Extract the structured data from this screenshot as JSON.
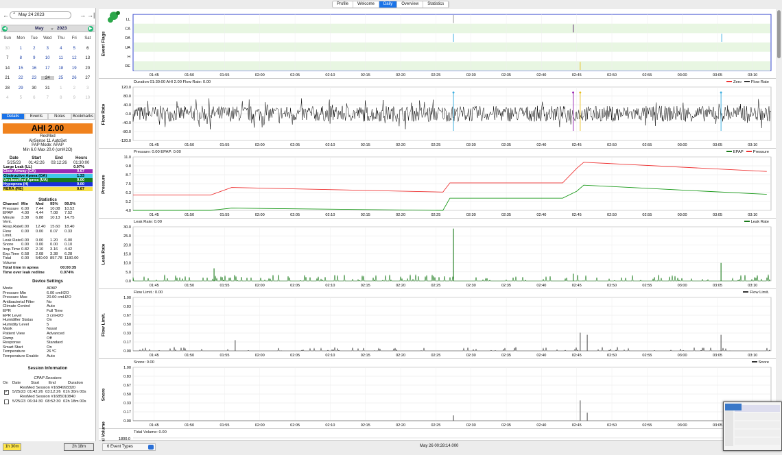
{
  "top_tabs": [
    "Profile",
    "Welcome",
    "Daily",
    "Overview",
    "Statistics"
  ],
  "active_tab": "Daily",
  "nav": {
    "prev": "←",
    "date": "May 24 2023",
    "next": "→",
    "last": "→|"
  },
  "calendar": {
    "month": "May",
    "year": "2023",
    "weekdays": [
      "Sun",
      "Mon",
      "Tue",
      "Wed",
      "Thu",
      "Fri",
      "Sat"
    ],
    "weeks": [
      [
        "30",
        "1",
        "2",
        "3",
        "4",
        "5",
        "6"
      ],
      [
        "7",
        "8",
        "9",
        "10",
        "11",
        "12",
        "13"
      ],
      [
        "14",
        "15",
        "16",
        "17",
        "18",
        "19",
        "20"
      ],
      [
        "21",
        "22",
        "23",
        "24",
        "25",
        "26",
        "27"
      ],
      [
        "28",
        "29",
        "30",
        "31",
        "1",
        "2",
        "3"
      ],
      [
        "4",
        "5",
        "6",
        "7",
        "8",
        "9",
        "10"
      ]
    ]
  },
  "sub_tabs": [
    "Details",
    "Events",
    "Notes",
    "Bookmarks"
  ],
  "ahi": "AHI 2.00",
  "machine": {
    "brand": "ResMed",
    "model": "AirSense 11 AutoSet",
    "mode": "PAP Mode: APAP",
    "range": "Min 6.0 Max 20.0 (cmH2O)"
  },
  "summary": {
    "headers": [
      "Date",
      "Start",
      "End",
      "Hours"
    ],
    "values": [
      "5/25/23",
      "01:42:26",
      "03:12:26",
      "01:30:00"
    ]
  },
  "events": [
    {
      "label": "Large Leak (LL)",
      "value": "0.07%",
      "color": "#ffffff",
      "text": "#000"
    },
    {
      "label": "Clear Airway (CA)",
      "value": "0.67",
      "color": "#9b2bb3",
      "text": "#fff"
    },
    {
      "label": "Obstructive Apnea (OA)",
      "value": "1.33",
      "color": "#40c8e8",
      "text": "#000"
    },
    {
      "label": "Unclassified Apnea (UA)",
      "value": "0.00",
      "color": "#1a7a1a",
      "text": "#fff"
    },
    {
      "label": "Hypopnea (H)",
      "value": "0.00",
      "color": "#1a2fd8",
      "text": "#fff"
    },
    {
      "label": "RERA (RE)",
      "value": "0.67",
      "color": "#f4e04a",
      "text": "#000"
    }
  ],
  "stats": {
    "title": "Statistics",
    "headers": [
      "Channel",
      "Min",
      "Med",
      "95%",
      "99.5%"
    ],
    "rows": [
      [
        "Pressure",
        "6.00",
        "7.44",
        "10.08",
        "10.52"
      ],
      [
        "EPAP",
        "4.00",
        "4.44",
        "7.08",
        "7.52"
      ],
      [
        "Minute",
        "3.38",
        "6.88",
        "10.13",
        "14.75"
      ],
      [
        "Vent.",
        "",
        "",
        "",
        ""
      ],
      [
        "Resp.Rate",
        "0.00",
        "12.40",
        "15.60",
        "18.40"
      ],
      [
        "Flow Limit.",
        "0.00",
        "0.00",
        "0.07",
        "0.33"
      ],
      [
        "Leak Rate",
        "0.00",
        "0.00",
        "1.20",
        "6.00"
      ],
      [
        "Snore",
        "0.00",
        "0.00",
        "0.00",
        "0.10"
      ],
      [
        "Insp.Time",
        "0.82",
        "2.10",
        "3.16",
        "4.42"
      ],
      [
        "Exp.Time",
        "0.58",
        "2.68",
        "3.38",
        "6.28"
      ],
      [
        "Tidal",
        "0.00",
        "540.00",
        "857.78",
        "1180.00"
      ],
      [
        "Volume",
        "",
        "",
        "",
        ""
      ]
    ],
    "apnea_label": "Total time in apnea",
    "apnea_value": "00:00:35",
    "leak_label": "Time over leak redline",
    "leak_value": "0.074%"
  },
  "device": {
    "title": "Device Settings",
    "rows": [
      [
        "Mode",
        "APAP"
      ],
      [
        "Pressure Min",
        "6.00 cmH2O"
      ],
      [
        "Pressure Max",
        "20.00 cmH2O"
      ],
      [
        "Antibacterial Filter",
        "No"
      ],
      [
        "Climate Control",
        "Auto"
      ],
      [
        "EPR",
        "Full Time"
      ],
      [
        "EPR Level",
        "3 cmH2O"
      ],
      [
        "Humidifier Status",
        "On"
      ],
      [
        "Humidity Level",
        "5"
      ],
      [
        "Mask",
        "Nasal"
      ],
      [
        "Patient View",
        "Advanced"
      ],
      [
        "Ramp",
        "Off"
      ],
      [
        "Response",
        "Standard"
      ],
      [
        "Smart Start",
        "On"
      ],
      [
        "Temperature",
        "26 ºC"
      ],
      [
        "Temperature Enable",
        "Auto"
      ]
    ]
  },
  "sessions": {
    "title": "Session Information",
    "subtitle": "CPAP Sessions",
    "headers": [
      "On",
      "Date",
      "Start",
      "End",
      "Duration"
    ],
    "items": [
      {
        "name": "ResMed Session #1684993320",
        "date": "5/25/23",
        "start": "01:42:26",
        "end": "03:12:26",
        "duration": "01h 30m 00s",
        "checked": true
      },
      {
        "name": "ResMed Session #1685010840",
        "date": "5/25/23",
        "start": "06:34:30",
        "end": "08:52:30",
        "duration": "02h 18m 00s",
        "checked": false
      }
    ]
  },
  "bottom_left": {
    "btn1": "1h 30m",
    "btn2": "2h 18m"
  },
  "bottom": {
    "event_types": "6 Event Types",
    "time": "May 26 00:28:14.000"
  },
  "x_ticks": [
    "01:45",
    "01:50",
    "01:55",
    "02:00",
    "02:05",
    "02:10",
    "02:15",
    "02:20",
    "02:25",
    "02:30",
    "02:35",
    "02:40",
    "02:45",
    "02:50",
    "02:55",
    "03:00",
    "03:05",
    "03:10"
  ],
  "chart_data": [
    {
      "type": "line",
      "title": "Event Flags",
      "ylabel": "Event Flags",
      "categories": [
        "LL",
        "CA",
        "OA",
        "UA",
        "H",
        "RE"
      ],
      "events": [
        {
          "flag": "LL",
          "time": "02:27"
        },
        {
          "flag": "CA",
          "time": "02:44"
        },
        {
          "flag": "OA",
          "time": "02:27"
        },
        {
          "flag": "OA",
          "time": "03:05"
        },
        {
          "flag": "RE",
          "time": "02:45"
        }
      ]
    },
    {
      "type": "line",
      "title": "Duration 01:30:00 AHI 2.00 Flow Rate: 0.00",
      "ylabel": "Flow Rate",
      "ylim": [
        -120,
        120
      ],
      "yticks": [
        "120.0",
        "80.0",
        "40.0",
        "0.0",
        "-40.0",
        "-80.0",
        "-120.0"
      ],
      "legend": [
        "Zero",
        "Flow Rate"
      ]
    },
    {
      "type": "line",
      "title": "Pressure: 0.00 EPAP: 0.00",
      "ylabel": "Pressure",
      "ylim": [
        4,
        11
      ],
      "yticks": [
        "11.0",
        "9.8",
        "8.7",
        "7.5",
        "6.3",
        "5.2",
        "4.0"
      ],
      "legend": [
        "EPAP",
        "Pressure"
      ],
      "series": [
        {
          "name": "Pressure",
          "x": [
            "01:42",
            "01:53",
            "01:56",
            "02:26",
            "02:27",
            "02:43",
            "02:45",
            "02:46",
            "03:12"
          ],
          "values": [
            6.0,
            6.0,
            7.0,
            6.4,
            7.6,
            7.6,
            9.5,
            10.3,
            9.1
          ]
        },
        {
          "name": "EPAP",
          "x": [
            "01:42",
            "01:53",
            "01:56",
            "02:26",
            "02:27",
            "02:43",
            "02:45",
            "02:46",
            "03:12"
          ],
          "values": [
            4.0,
            4.0,
            4.3,
            4.0,
            5.6,
            5.6,
            6.5,
            7.3,
            6.1
          ]
        }
      ]
    },
    {
      "type": "line",
      "title": "Leak Rate: 0.00",
      "ylabel": "Leak Rate",
      "ylim": [
        0,
        30
      ],
      "yticks": [
        "30.0",
        "25.0",
        "20.0",
        "15.0",
        "10.0",
        "5.0",
        "0.0"
      ],
      "legend": [
        "Leak Rate"
      ]
    },
    {
      "type": "line",
      "title": "Flow Limit.: 0.00",
      "ylabel": "Flow Limit.",
      "ylim": [
        0,
        1
      ],
      "yticks": [
        "1.00",
        "0.83",
        "0.67",
        "0.50",
        "0.33",
        "0.17",
        "0.00"
      ],
      "legend": [
        "Flow Limit."
      ]
    },
    {
      "type": "line",
      "title": "Snore: 0.00",
      "ylabel": "Snore",
      "ylim": [
        0,
        1
      ],
      "yticks": [
        "1.00",
        "0.83",
        "0.67",
        "0.50",
        "0.33",
        "0.17",
        "0.00"
      ],
      "legend": [
        "Snore"
      ]
    },
    {
      "type": "line",
      "title": "Tidal Volume: 0.00",
      "ylabel": "Tidal Volume",
      "yticks": [
        "1800.0"
      ]
    }
  ]
}
